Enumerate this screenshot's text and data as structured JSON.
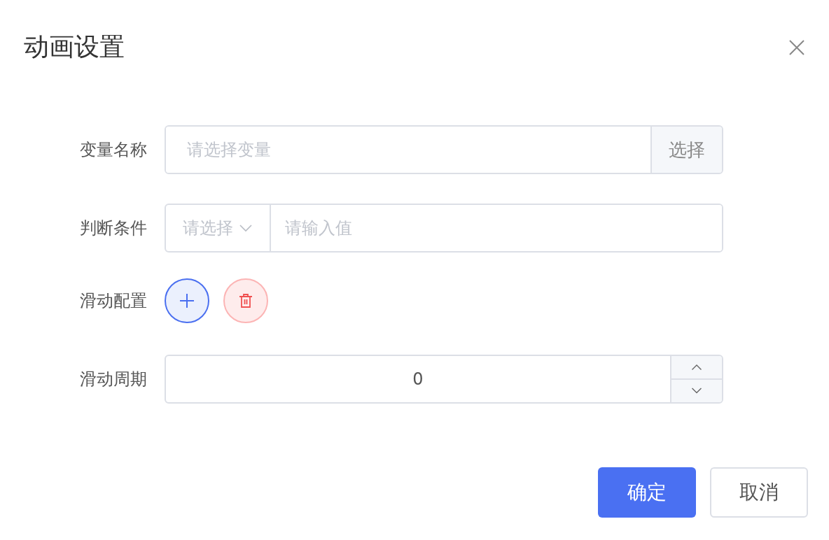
{
  "dialog": {
    "title": "动画设置"
  },
  "form": [
    {
      "kind": "input-append",
      "label": "变量名称",
      "placeholder": "请选择变量",
      "append": "选择"
    },
    {
      "kind": "select-input",
      "label": "判断条件",
      "select_placeholder": "请选择",
      "placeholder": "请输入值"
    },
    {
      "kind": "icon-buttons",
      "label": "滑动配置"
    },
    {
      "kind": "number",
      "label": "滑动周期",
      "value": "0"
    }
  ],
  "buttons": [
    {
      "kind": "primary",
      "label": "确定"
    },
    {
      "kind": "default",
      "label": "取消"
    }
  ]
}
